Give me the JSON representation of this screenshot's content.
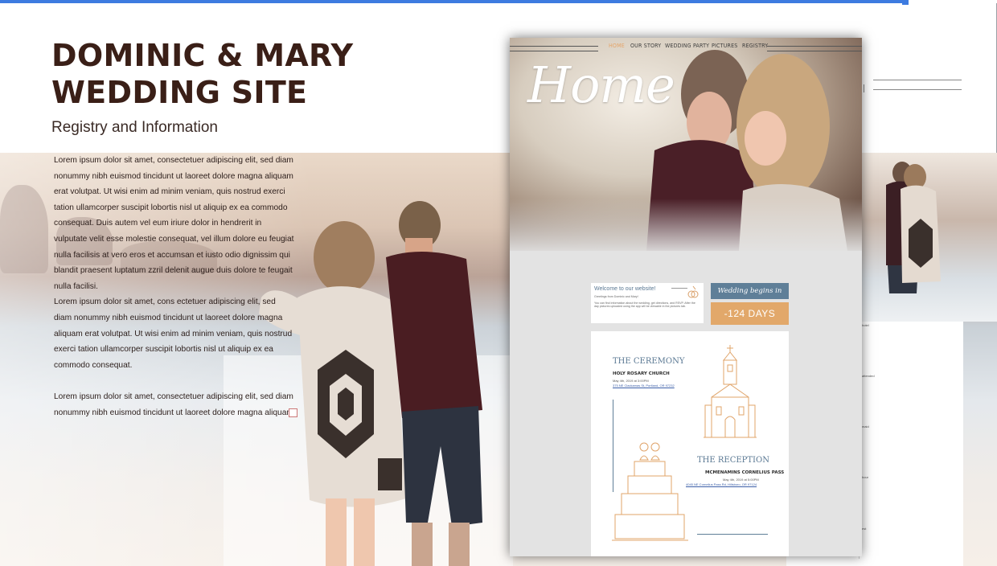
{
  "header": {
    "title_line1": "DOMINIC & MARY",
    "title_line2": "WEDDING SITE",
    "subtitle": "Registry and Information"
  },
  "body_paragraphs": [
    "Lorem ipsum dolor sit amet, consectetuer adipiscing elit, sed diam nonummy nibh euismod tincidunt ut laoreet dolore magna aliquam erat volutpat. Ut wisi enim ad minim veniam, quis nostrud exerci tation ullamcorper suscipit lobortis nisl ut aliquip ex ea commodo consequat. Duis autem vel eum iriure dolor in hendrerit in vulputate velit esse molestie consequat, vel illum dolore eu feugiat nulla facilisis at vero eros et accumsan et iusto odio dignissim qui blandit praesent luptatum zzril delenit augue duis dolore te feugait nulla facilisi.",
    "Lorem ipsum dolor sit amet, cons ectetuer adipiscing elit, sed diam nonummy nibh euismod tincidunt ut laoreet dolore magna aliquam erat volutpat. Ut wisi enim ad minim veniam, quis nostrud exerci tation ullamcorper suscipit lobortis nisl ut aliquip ex ea commodo consequat.",
    "Lorem ipsum dolor sit amet, consectetuer adipiscing elit, sed diam nonummy nibh euismod tincidunt ut laoreet dolore magna aliquam"
  ],
  "mockup": {
    "nav": [
      "HOME",
      "OUR STORY",
      "WEDDING PARTY",
      "PICTURES",
      "REGISTRY"
    ],
    "hero_title": "Home",
    "welcome": {
      "title": "Welcome to our website!",
      "greeting": "Greetings from Dominic and Mary!",
      "text": "You can find information about the wedding, get directions, and RSVP. After the day pictures uploaded using the app will be viewable in the pictures tab."
    },
    "countdown": {
      "label": "Wedding begins in",
      "value": "-124 DAYS"
    },
    "ceremony": {
      "title": "THE CEREMONY",
      "venue": "HOLY ROSARY CHURCH",
      "date": "May 4th, 2019 at 3:00PM",
      "address": "375 NE Clackamas St, Portland, OR 97232"
    },
    "reception": {
      "title": "THE RECEPTION",
      "venue": "MCMENAMINS CORNELIUS PASS",
      "date": "May 4th, 2019 at 5:00PM",
      "address": "4045 NE Cornelius Pass Rd, Hillsboro, OR 97124"
    }
  },
  "colors": {
    "accent_blue": "#5f7f98",
    "accent_orange": "#e2a86a",
    "title_brown": "#3a1f17",
    "topbar": "#3d7be0"
  }
}
